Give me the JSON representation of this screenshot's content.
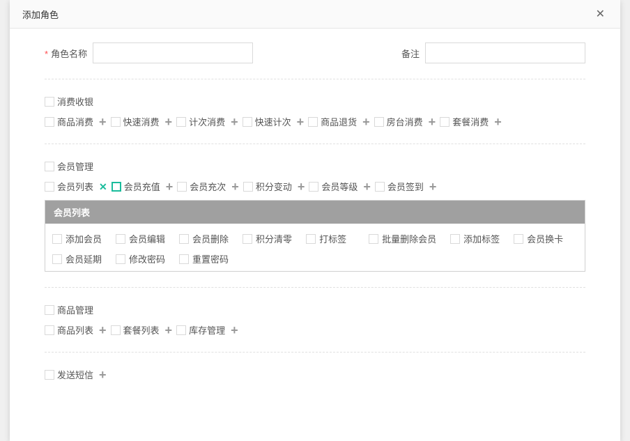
{
  "modal": {
    "title": "添加角色",
    "close": "✕"
  },
  "form": {
    "name_label": "角色名称",
    "remark_label": "备注"
  },
  "sections": {
    "s1": {
      "title": "消费收银",
      "items": [
        "商品消费",
        "快速消费",
        "计次消费",
        "快速计次",
        "商品退货",
        "房台消费",
        "套餐消费"
      ]
    },
    "s2": {
      "title": "会员管理",
      "items": [
        "会员列表",
        "会员充值",
        "会员充次",
        "积分变动",
        "会员等级",
        "会员签到"
      ],
      "expanded": {
        "title": "会员列表",
        "subitems": [
          "添加会员",
          "会员编辑",
          "会员删除",
          "积分清零",
          "打标签",
          "批量删除会员",
          "添加标签",
          "会员换卡",
          "会员延期",
          "修改密码",
          "重置密码"
        ]
      }
    },
    "s3": {
      "title": "商品管理",
      "items": [
        "商品列表",
        "套餐列表",
        "库存管理"
      ]
    },
    "s4": {
      "title": "发送短信"
    }
  }
}
